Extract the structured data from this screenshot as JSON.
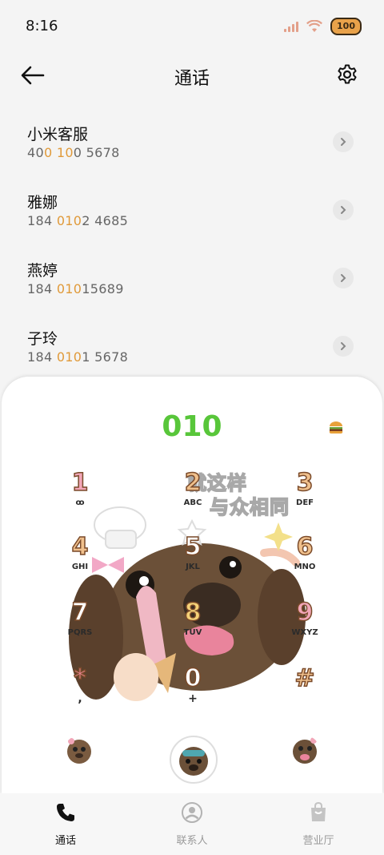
{
  "status": {
    "time": "8:16",
    "battery": "100"
  },
  "header": {
    "title": "通话",
    "back_icon": "arrow-left-icon",
    "settings_icon": "gear-icon"
  },
  "contacts": [
    {
      "name": "小米客服",
      "number_parts": [
        "40",
        "0 10",
        "0 5678"
      ]
    },
    {
      "name": "雅娜",
      "number_parts": [
        "184 ",
        "010",
        "2 4685"
      ]
    },
    {
      "name": "燕婷",
      "number_parts": [
        "184 ",
        "010",
        "15689"
      ]
    },
    {
      "name": "子玲",
      "number_parts": [
        "184 ",
        "010",
        "1 5678"
      ]
    }
  ],
  "dialer": {
    "input": "010",
    "caption_line1": "就这样",
    "caption_line2": "与众相同",
    "keys": [
      {
        "digit": "1",
        "letters": "ꝏ"
      },
      {
        "digit": "2",
        "letters": "ABC"
      },
      {
        "digit": "3",
        "letters": "DEF"
      },
      {
        "digit": "4",
        "letters": "GHI"
      },
      {
        "digit": "5",
        "letters": "JKL"
      },
      {
        "digit": "6",
        "letters": "MNO"
      },
      {
        "digit": "7",
        "letters": "PQRS"
      },
      {
        "digit": "8",
        "letters": "TUV"
      },
      {
        "digit": "9",
        "letters": "WXYZ"
      },
      {
        "digit": "*",
        "letters": ","
      },
      {
        "digit": "0",
        "letters": "+"
      },
      {
        "digit": "#",
        "letters": ""
      }
    ]
  },
  "nav": [
    {
      "label": "通话",
      "icon": "phone-icon",
      "active": true
    },
    {
      "label": "联系人",
      "icon": "person-icon",
      "active": false
    },
    {
      "label": "营业厅",
      "icon": "shopping-bag-icon",
      "active": false
    }
  ],
  "colors": {
    "dialed": "#58c63a",
    "highlight": "#e09a3a",
    "accent_key": "#f0c08c"
  }
}
